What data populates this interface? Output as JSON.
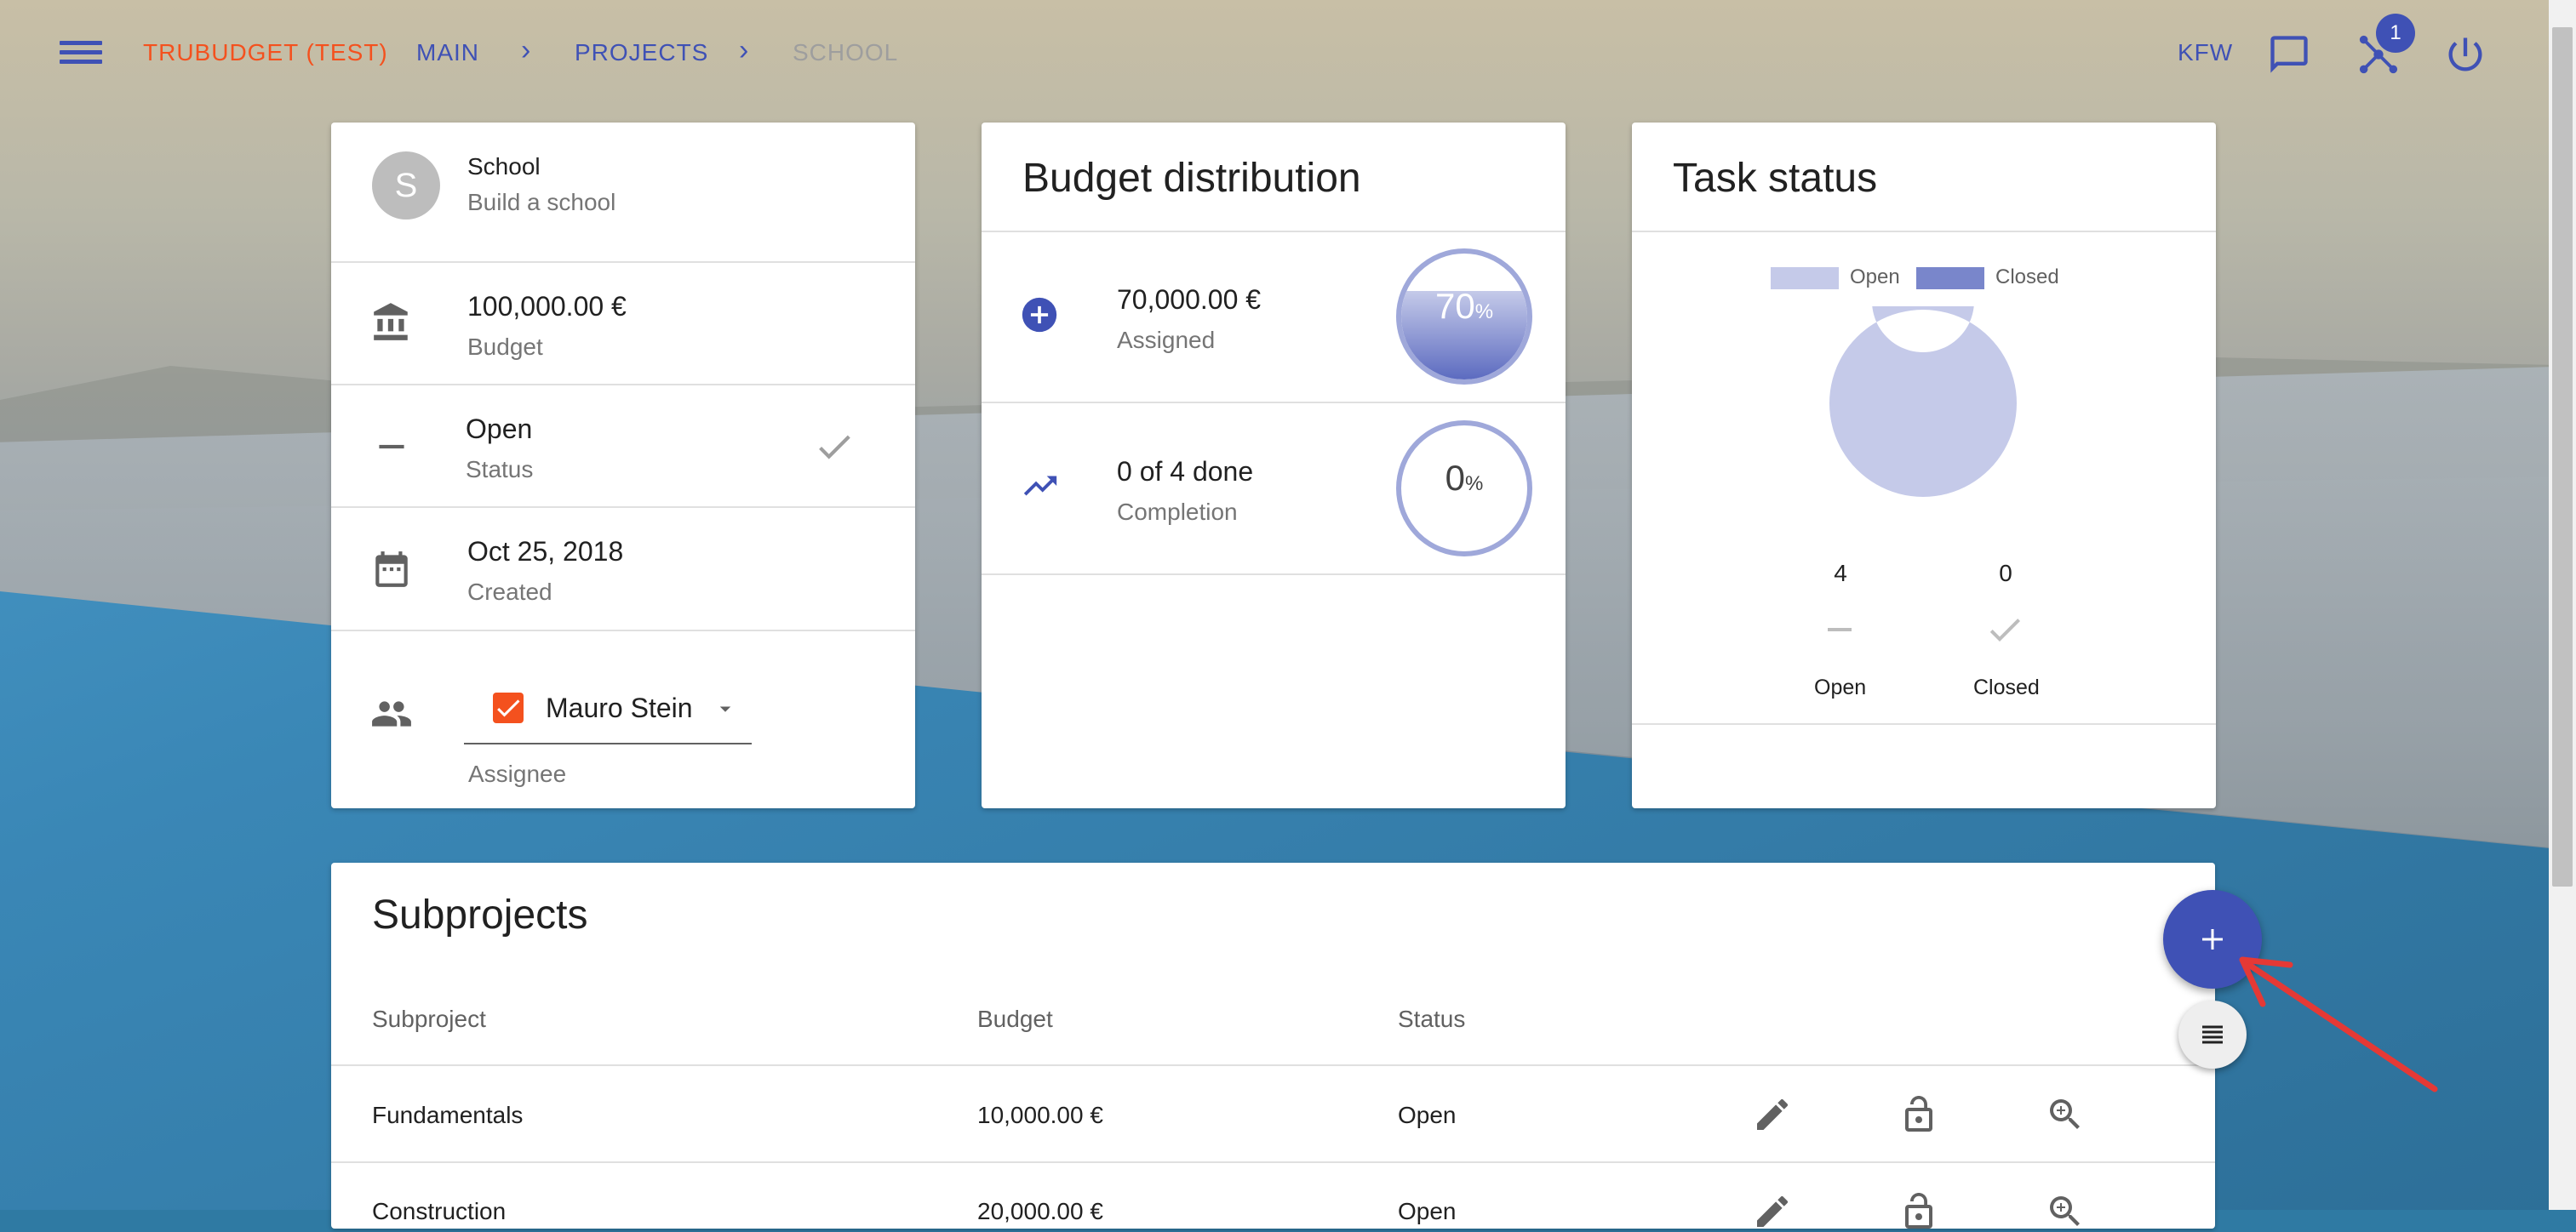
{
  "breadcrumb": {
    "brand": "TRUBUDGET (TEST)",
    "main": "MAIN",
    "projects": "PROJECTS",
    "current": "SCHOOL",
    "separator": "›"
  },
  "header": {
    "organization": "KFW",
    "notification_count": "1",
    "icons": [
      "menu-icon",
      "message-icon",
      "network-icon",
      "power-icon"
    ]
  },
  "project_card": {
    "avatar_letter": "S",
    "name": "School",
    "description": "Build a school",
    "budget_value": "100,000.00 €",
    "budget_label": "Budget",
    "status_value": "Open",
    "status_label": "Status",
    "created_value": "Oct 25, 2018",
    "created_label": "Created",
    "assignee_value": "Mauro Stein",
    "assignee_label": "Assignee"
  },
  "budget_card": {
    "title": "Budget distribution",
    "assigned_value": "70,000.00 €",
    "assigned_label": "Assigned",
    "assigned_percent": "70",
    "completion_value": "0 of 4 done",
    "completion_label": "Completion",
    "completion_percent": "0",
    "percent_sign": "%"
  },
  "task_card": {
    "title": "Task status",
    "legend_open": "Open",
    "legend_closed": "Closed",
    "open_count": "4",
    "closed_count": "0",
    "open_label": "Open",
    "closed_label": "Closed"
  },
  "chart_data": {
    "type": "pie",
    "categories": [
      "Open",
      "Closed"
    ],
    "values": [
      4,
      0
    ],
    "colors": [
      "#c5cae9",
      "#7986cb"
    ],
    "legend": "top"
  },
  "subprojects": {
    "title": "Subprojects",
    "columns": [
      "Subproject",
      "Budget",
      "Status"
    ],
    "rows": [
      {
        "name": "Fundamentals",
        "budget": "10,000.00 €",
        "status": "Open"
      },
      {
        "name": "Construction",
        "budget": "20,000.00 €",
        "status": "Open"
      }
    ]
  },
  "colors": {
    "primary": "#3f51b5",
    "accent": "#f4511e",
    "open": "#c5cae9",
    "closed": "#7986cb"
  }
}
